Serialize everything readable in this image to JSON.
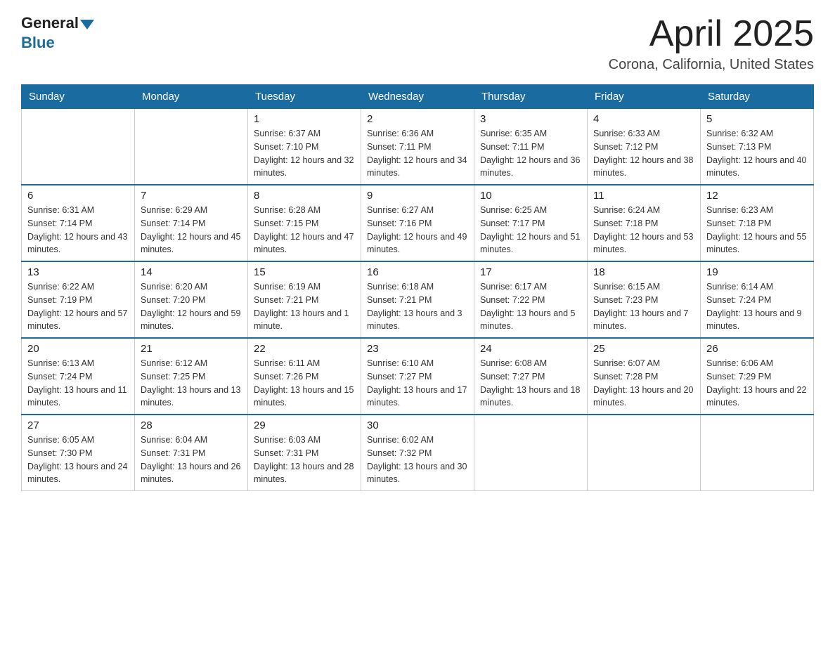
{
  "header": {
    "logo_general": "General",
    "logo_blue": "Blue",
    "title": "April 2025",
    "subtitle": "Corona, California, United States"
  },
  "days_of_week": [
    "Sunday",
    "Monday",
    "Tuesday",
    "Wednesday",
    "Thursday",
    "Friday",
    "Saturday"
  ],
  "weeks": [
    [
      {
        "day": "",
        "sunrise": "",
        "sunset": "",
        "daylight": ""
      },
      {
        "day": "",
        "sunrise": "",
        "sunset": "",
        "daylight": ""
      },
      {
        "day": "1",
        "sunrise": "Sunrise: 6:37 AM",
        "sunset": "Sunset: 7:10 PM",
        "daylight": "Daylight: 12 hours and 32 minutes."
      },
      {
        "day": "2",
        "sunrise": "Sunrise: 6:36 AM",
        "sunset": "Sunset: 7:11 PM",
        "daylight": "Daylight: 12 hours and 34 minutes."
      },
      {
        "day": "3",
        "sunrise": "Sunrise: 6:35 AM",
        "sunset": "Sunset: 7:11 PM",
        "daylight": "Daylight: 12 hours and 36 minutes."
      },
      {
        "day": "4",
        "sunrise": "Sunrise: 6:33 AM",
        "sunset": "Sunset: 7:12 PM",
        "daylight": "Daylight: 12 hours and 38 minutes."
      },
      {
        "day": "5",
        "sunrise": "Sunrise: 6:32 AM",
        "sunset": "Sunset: 7:13 PM",
        "daylight": "Daylight: 12 hours and 40 minutes."
      }
    ],
    [
      {
        "day": "6",
        "sunrise": "Sunrise: 6:31 AM",
        "sunset": "Sunset: 7:14 PM",
        "daylight": "Daylight: 12 hours and 43 minutes."
      },
      {
        "day": "7",
        "sunrise": "Sunrise: 6:29 AM",
        "sunset": "Sunset: 7:14 PM",
        "daylight": "Daylight: 12 hours and 45 minutes."
      },
      {
        "day": "8",
        "sunrise": "Sunrise: 6:28 AM",
        "sunset": "Sunset: 7:15 PM",
        "daylight": "Daylight: 12 hours and 47 minutes."
      },
      {
        "day": "9",
        "sunrise": "Sunrise: 6:27 AM",
        "sunset": "Sunset: 7:16 PM",
        "daylight": "Daylight: 12 hours and 49 minutes."
      },
      {
        "day": "10",
        "sunrise": "Sunrise: 6:25 AM",
        "sunset": "Sunset: 7:17 PM",
        "daylight": "Daylight: 12 hours and 51 minutes."
      },
      {
        "day": "11",
        "sunrise": "Sunrise: 6:24 AM",
        "sunset": "Sunset: 7:18 PM",
        "daylight": "Daylight: 12 hours and 53 minutes."
      },
      {
        "day": "12",
        "sunrise": "Sunrise: 6:23 AM",
        "sunset": "Sunset: 7:18 PM",
        "daylight": "Daylight: 12 hours and 55 minutes."
      }
    ],
    [
      {
        "day": "13",
        "sunrise": "Sunrise: 6:22 AM",
        "sunset": "Sunset: 7:19 PM",
        "daylight": "Daylight: 12 hours and 57 minutes."
      },
      {
        "day": "14",
        "sunrise": "Sunrise: 6:20 AM",
        "sunset": "Sunset: 7:20 PM",
        "daylight": "Daylight: 12 hours and 59 minutes."
      },
      {
        "day": "15",
        "sunrise": "Sunrise: 6:19 AM",
        "sunset": "Sunset: 7:21 PM",
        "daylight": "Daylight: 13 hours and 1 minute."
      },
      {
        "day": "16",
        "sunrise": "Sunrise: 6:18 AM",
        "sunset": "Sunset: 7:21 PM",
        "daylight": "Daylight: 13 hours and 3 minutes."
      },
      {
        "day": "17",
        "sunrise": "Sunrise: 6:17 AM",
        "sunset": "Sunset: 7:22 PM",
        "daylight": "Daylight: 13 hours and 5 minutes."
      },
      {
        "day": "18",
        "sunrise": "Sunrise: 6:15 AM",
        "sunset": "Sunset: 7:23 PM",
        "daylight": "Daylight: 13 hours and 7 minutes."
      },
      {
        "day": "19",
        "sunrise": "Sunrise: 6:14 AM",
        "sunset": "Sunset: 7:24 PM",
        "daylight": "Daylight: 13 hours and 9 minutes."
      }
    ],
    [
      {
        "day": "20",
        "sunrise": "Sunrise: 6:13 AM",
        "sunset": "Sunset: 7:24 PM",
        "daylight": "Daylight: 13 hours and 11 minutes."
      },
      {
        "day": "21",
        "sunrise": "Sunrise: 6:12 AM",
        "sunset": "Sunset: 7:25 PM",
        "daylight": "Daylight: 13 hours and 13 minutes."
      },
      {
        "day": "22",
        "sunrise": "Sunrise: 6:11 AM",
        "sunset": "Sunset: 7:26 PM",
        "daylight": "Daylight: 13 hours and 15 minutes."
      },
      {
        "day": "23",
        "sunrise": "Sunrise: 6:10 AM",
        "sunset": "Sunset: 7:27 PM",
        "daylight": "Daylight: 13 hours and 17 minutes."
      },
      {
        "day": "24",
        "sunrise": "Sunrise: 6:08 AM",
        "sunset": "Sunset: 7:27 PM",
        "daylight": "Daylight: 13 hours and 18 minutes."
      },
      {
        "day": "25",
        "sunrise": "Sunrise: 6:07 AM",
        "sunset": "Sunset: 7:28 PM",
        "daylight": "Daylight: 13 hours and 20 minutes."
      },
      {
        "day": "26",
        "sunrise": "Sunrise: 6:06 AM",
        "sunset": "Sunset: 7:29 PM",
        "daylight": "Daylight: 13 hours and 22 minutes."
      }
    ],
    [
      {
        "day": "27",
        "sunrise": "Sunrise: 6:05 AM",
        "sunset": "Sunset: 7:30 PM",
        "daylight": "Daylight: 13 hours and 24 minutes."
      },
      {
        "day": "28",
        "sunrise": "Sunrise: 6:04 AM",
        "sunset": "Sunset: 7:31 PM",
        "daylight": "Daylight: 13 hours and 26 minutes."
      },
      {
        "day": "29",
        "sunrise": "Sunrise: 6:03 AM",
        "sunset": "Sunset: 7:31 PM",
        "daylight": "Daylight: 13 hours and 28 minutes."
      },
      {
        "day": "30",
        "sunrise": "Sunrise: 6:02 AM",
        "sunset": "Sunset: 7:32 PM",
        "daylight": "Daylight: 13 hours and 30 minutes."
      },
      {
        "day": "",
        "sunrise": "",
        "sunset": "",
        "daylight": ""
      },
      {
        "day": "",
        "sunrise": "",
        "sunset": "",
        "daylight": ""
      },
      {
        "day": "",
        "sunrise": "",
        "sunset": "",
        "daylight": ""
      }
    ]
  ]
}
